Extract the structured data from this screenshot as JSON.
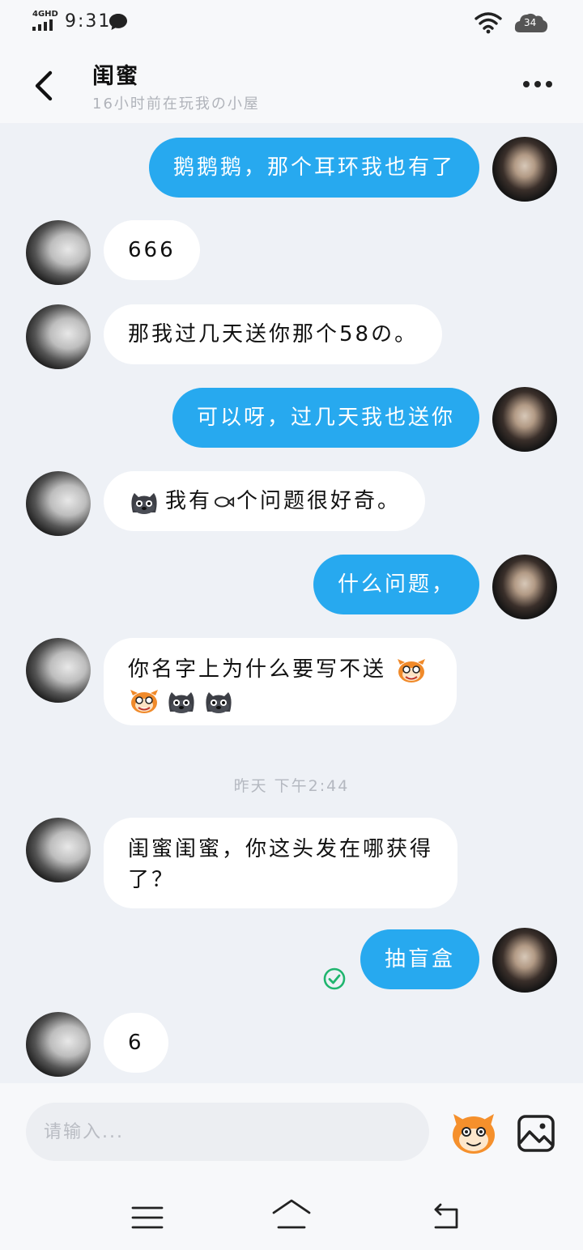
{
  "status_bar": {
    "network": "4GHD",
    "time": "9:31",
    "battery": "34"
  },
  "header": {
    "title": "闺蜜",
    "subtitle": "16小时前在玩我の小屋"
  },
  "messages": [
    {
      "from": "me",
      "lines": [
        "鹅鹅鹅，那个耳环我也有了"
      ]
    },
    {
      "from": "friend",
      "lines": [
        "666"
      ]
    },
    {
      "from": "friend",
      "lines": [
        "那我过几天送你那个58の。"
      ]
    },
    {
      "from": "me",
      "lines": [
        "可以呀，过几天我也送你"
      ]
    },
    {
      "from": "friend",
      "lines": [
        "我有",
        "个问题很好奇。"
      ]
    },
    {
      "from": "me",
      "lines": [
        "什么问题，"
      ]
    },
    {
      "from": "friend",
      "lines": [
        "你名字上为什么要写不送"
      ]
    },
    {
      "from": "friend",
      "lines": [
        "闺蜜闺蜜，你这头发在哪获得",
        "了？"
      ]
    },
    {
      "from": "me",
      "lines": [
        "抽盲盒"
      ]
    },
    {
      "from": "friend",
      "lines": [
        "6"
      ]
    }
  ],
  "time_divider": "昨天 下午2:44",
  "input": {
    "placeholder": "请输入..."
  },
  "icons": {
    "back": "chevron-left-icon",
    "more": "more-dots-icon",
    "emoji": "emoji-face-icon",
    "image": "image-icon",
    "sent": "check-circle-icon"
  },
  "colors": {
    "my_bubble": "#27a9ef",
    "friend_bubble": "#ffffff",
    "background": "#eef1f6",
    "sent_check": "#1fb56e"
  }
}
